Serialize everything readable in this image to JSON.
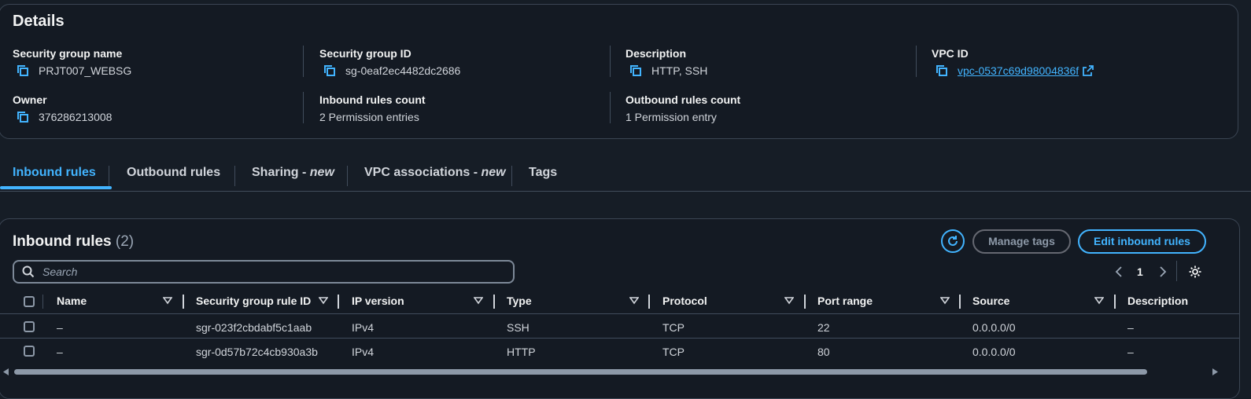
{
  "details": {
    "title": "Details",
    "sg_name_label": "Security group name",
    "sg_name_value": "PRJT007_WEBSG",
    "sg_id_label": "Security group ID",
    "sg_id_value": "sg-0eaf2ec4482dc2686",
    "description_label": "Description",
    "description_value": "HTTP, SSH",
    "vpc_label": "VPC ID",
    "vpc_value": "vpc-0537c69d98004836f",
    "owner_label": "Owner",
    "owner_value": "376286213008",
    "inbound_count_label": "Inbound rules count",
    "inbound_count_value": "2 Permission entries",
    "outbound_count_label": "Outbound rules count",
    "outbound_count_value": "1 Permission entry"
  },
  "tabs": {
    "inbound": "Inbound rules",
    "outbound": "Outbound rules",
    "sharing": "Sharing - ",
    "sharing_new": "new",
    "vpc_assoc": "VPC associations - ",
    "vpc_assoc_new": "new",
    "tags": "Tags"
  },
  "panel": {
    "title": "Inbound rules",
    "count": "(2)",
    "manage_tags": "Manage tags",
    "edit_inbound": "Edit inbound rules",
    "search_placeholder": "Search",
    "page": "1"
  },
  "table": {
    "columns": [
      "Name",
      "Security group rule ID",
      "IP version",
      "Type",
      "Protocol",
      "Port range",
      "Source",
      "Description"
    ],
    "rows": [
      {
        "name": "–",
        "rule_id": "sgr-023f2cbdabf5c1aab",
        "ip": "IPv4",
        "type": "SSH",
        "protocol": "TCP",
        "port": "22",
        "source": "0.0.0.0/0",
        "desc": "–"
      },
      {
        "name": "–",
        "rule_id": "sgr-0d57b72c4cb930a3b",
        "ip": "IPv4",
        "type": "HTTP",
        "protocol": "TCP",
        "port": "80",
        "source": "0.0.0.0/0",
        "desc": "–"
      }
    ]
  },
  "colors": {
    "accent": "#42b4ff",
    "background": "#161d26",
    "border": "#414d5c"
  }
}
